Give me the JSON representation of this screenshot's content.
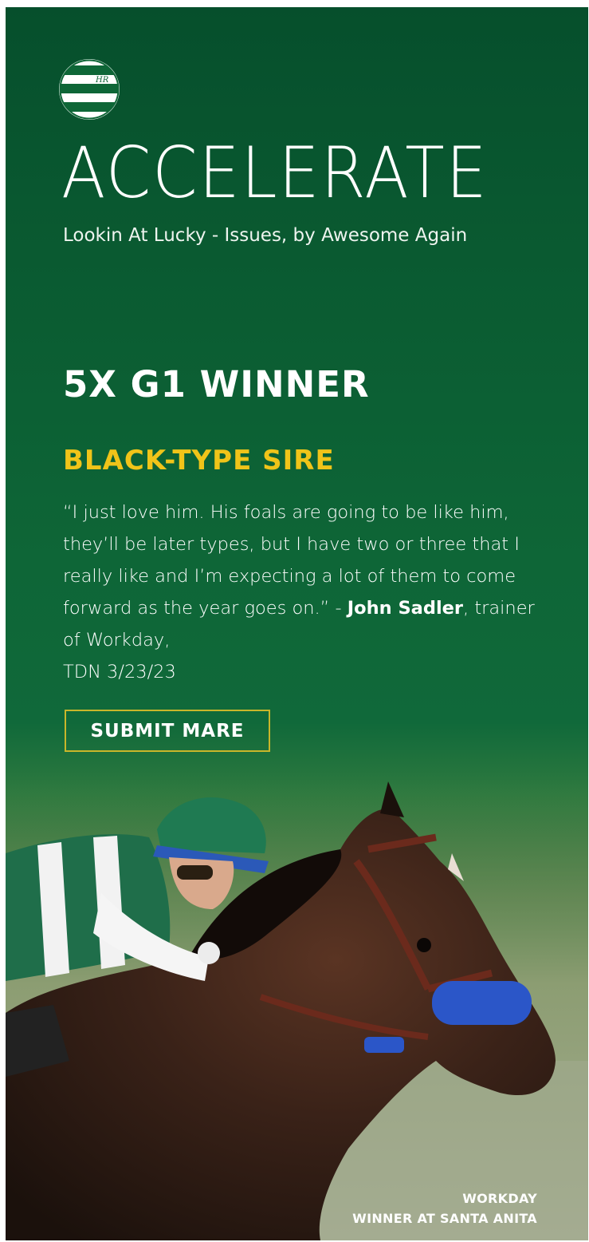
{
  "brand": {
    "logo_lettering": "HR"
  },
  "hero": {
    "title": "ACCELERATE",
    "pedigree": "Lookin At Lucky - Issues, by Awesome Again"
  },
  "headline": "5X G1 WINNER",
  "subheadline": "BLACK-TYPE SIRE",
  "testimonial": {
    "quote_open": "“I just love him. His foals are going to be like him, they’ll be later types, but I have two or three that I really like and I’m expecting a lot of them to come forward as the year goes on.” - ",
    "author": "John Sadler",
    "attribution": ", trainer of Workday,",
    "source": "TDN 3/23/23"
  },
  "cta": {
    "label": "SUBMIT MARE"
  },
  "photo_caption": {
    "line1": "WORKDAY",
    "line2": "WINNER AT SANTA ANITA"
  },
  "colors": {
    "background_green": "#0e6637",
    "accent_yellow": "#f0c419",
    "button_border": "#c9b62a",
    "text": "#ffffff"
  }
}
